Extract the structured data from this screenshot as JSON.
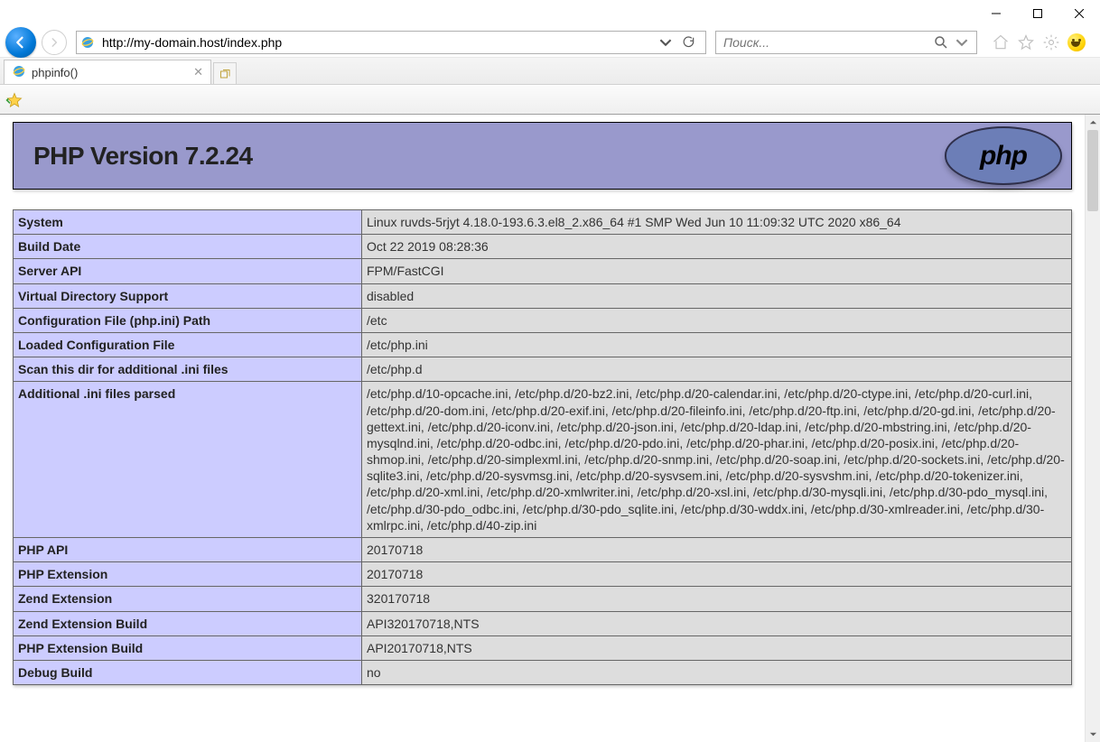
{
  "browser": {
    "url_display": "http://my-domain.host/index.php",
    "search_placeholder": "Поиск...",
    "tab_title": "phpinfo()"
  },
  "page": {
    "heading": "PHP Version 7.2.24",
    "rows": [
      {
        "label": "System",
        "value": "Linux ruvds-5rjyt 4.18.0-193.6.3.el8_2.x86_64 #1 SMP Wed Jun 10 11:09:32 UTC 2020 x86_64"
      },
      {
        "label": "Build Date",
        "value": "Oct 22 2019 08:28:36"
      },
      {
        "label": "Server API",
        "value": "FPM/FastCGI"
      },
      {
        "label": "Virtual Directory Support",
        "value": "disabled"
      },
      {
        "label": "Configuration File (php.ini) Path",
        "value": "/etc"
      },
      {
        "label": "Loaded Configuration File",
        "value": "/etc/php.ini"
      },
      {
        "label": "Scan this dir for additional .ini files",
        "value": "/etc/php.d"
      },
      {
        "label": "Additional .ini files parsed",
        "value": "/etc/php.d/10-opcache.ini, /etc/php.d/20-bz2.ini, /etc/php.d/20-calendar.ini, /etc/php.d/20-ctype.ini, /etc/php.d/20-curl.ini, /etc/php.d/20-dom.ini, /etc/php.d/20-exif.ini, /etc/php.d/20-fileinfo.ini, /etc/php.d/20-ftp.ini, /etc/php.d/20-gd.ini, /etc/php.d/20-gettext.ini, /etc/php.d/20-iconv.ini, /etc/php.d/20-json.ini, /etc/php.d/20-ldap.ini, /etc/php.d/20-mbstring.ini, /etc/php.d/20-mysqlnd.ini, /etc/php.d/20-odbc.ini, /etc/php.d/20-pdo.ini, /etc/php.d/20-phar.ini, /etc/php.d/20-posix.ini, /etc/php.d/20-shmop.ini, /etc/php.d/20-simplexml.ini, /etc/php.d/20-snmp.ini, /etc/php.d/20-soap.ini, /etc/php.d/20-sockets.ini, /etc/php.d/20-sqlite3.ini, /etc/php.d/20-sysvmsg.ini, /etc/php.d/20-sysvsem.ini, /etc/php.d/20-sysvshm.ini, /etc/php.d/20-tokenizer.ini, /etc/php.d/20-xml.ini, /etc/php.d/20-xmlwriter.ini, /etc/php.d/20-xsl.ini, /etc/php.d/30-mysqli.ini, /etc/php.d/30-pdo_mysql.ini, /etc/php.d/30-pdo_odbc.ini, /etc/php.d/30-pdo_sqlite.ini, /etc/php.d/30-wddx.ini, /etc/php.d/30-xmlreader.ini, /etc/php.d/30-xmlrpc.ini, /etc/php.d/40-zip.ini"
      },
      {
        "label": "PHP API",
        "value": "20170718"
      },
      {
        "label": "PHP Extension",
        "value": "20170718"
      },
      {
        "label": "Zend Extension",
        "value": "320170718"
      },
      {
        "label": "Zend Extension Build",
        "value": "API320170718,NTS"
      },
      {
        "label": "PHP Extension Build",
        "value": "API20170718,NTS"
      },
      {
        "label": "Debug Build",
        "value": "no"
      }
    ]
  }
}
